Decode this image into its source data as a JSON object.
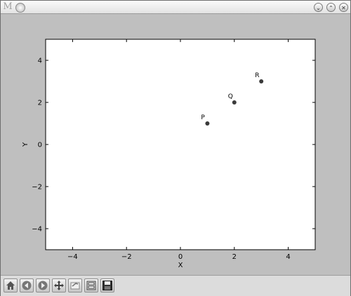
{
  "window": {
    "app_icon_glyph": "M",
    "minimize_glyph": "⌄",
    "maximize_glyph": "⌃",
    "close_glyph": "✕"
  },
  "toolbar": {
    "buttons": [
      {
        "name": "home-icon"
      },
      {
        "name": "back-icon"
      },
      {
        "name": "forward-icon"
      },
      {
        "name": "pan-icon"
      },
      {
        "name": "zoom-rect-icon"
      },
      {
        "name": "subplots-icon"
      },
      {
        "name": "save-icon"
      }
    ]
  },
  "chart_data": {
    "type": "scatter",
    "title": "",
    "xlabel": "X",
    "ylabel": "Y",
    "xlim": [
      -5,
      5
    ],
    "ylim": [
      -5,
      5
    ],
    "xticks": [
      -4,
      -2,
      0,
      2,
      4
    ],
    "yticks": [
      -4,
      -2,
      0,
      2,
      4
    ],
    "xtick_labels": [
      "−4",
      "−2",
      "0",
      "2",
      "4"
    ],
    "ytick_labels": [
      "−4",
      "−2",
      "0",
      "2",
      "4"
    ],
    "grid": false,
    "points": [
      {
        "label": "P",
        "x": 1,
        "y": 1
      },
      {
        "label": "Q",
        "x": 2,
        "y": 2
      },
      {
        "label": "R",
        "x": 3,
        "y": 3
      }
    ],
    "marker_color": "#3a3a3a"
  }
}
